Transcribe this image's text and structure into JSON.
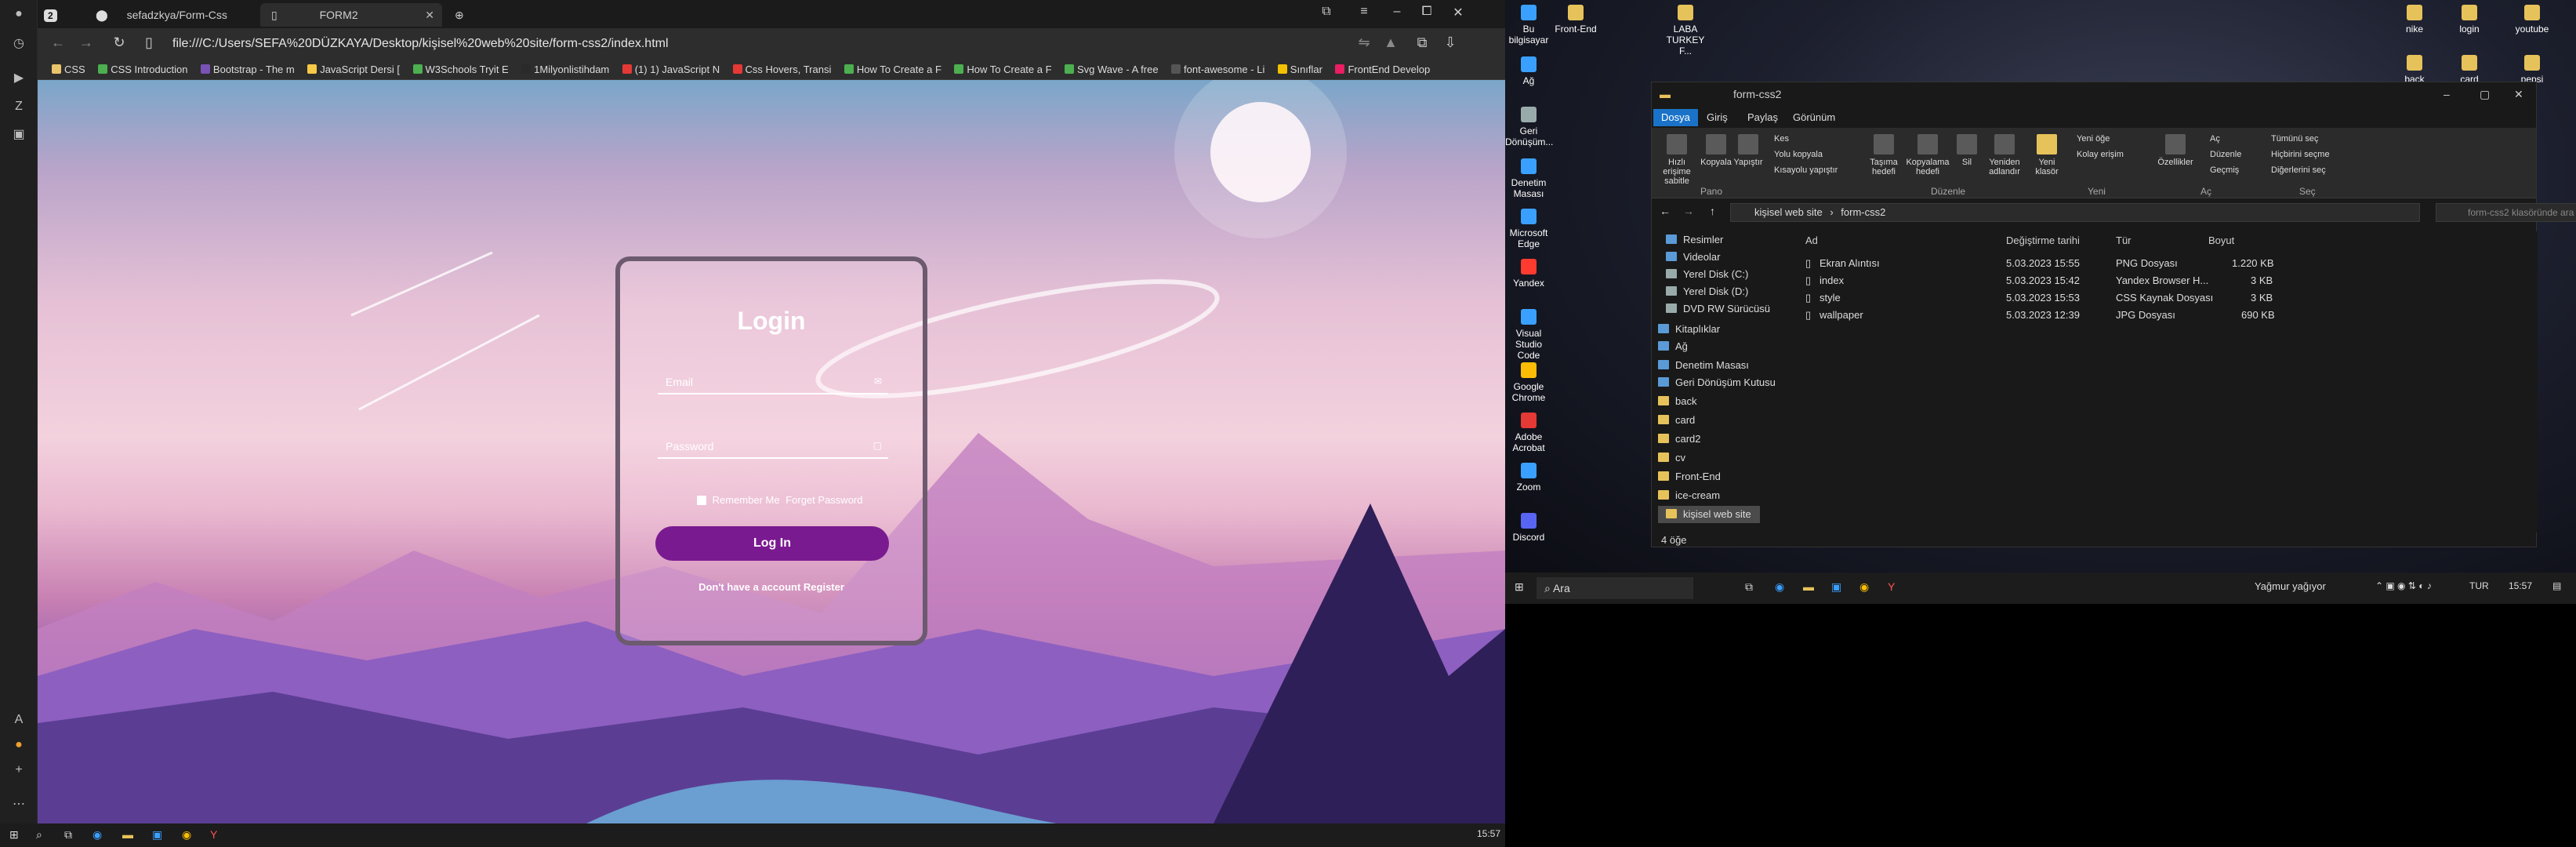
{
  "browser": {
    "tab_count": "2",
    "tabs": [
      {
        "title": "sefadzkya/Form-Css"
      },
      {
        "title": "FORM2"
      }
    ],
    "url": "file:///C:/Users/SEFA%20DÜZKAYA/Desktop/kişisel%20web%20site/form-css2/index.html",
    "bookmarks": [
      "CSS",
      "CSS Introduction",
      "Bootstrap - The m",
      "JavaScript Dersi [",
      "W3Schools Tryit E",
      "1Milyonlistihdam",
      "(1) 1) JavaScript N",
      "Css Hovers, Transi",
      "How To Create a F",
      "How To Create a F",
      "Svg Wave - A free",
      "font-awesome - Li",
      "Sınıflar",
      "FrontEnd Develop"
    ],
    "clock": "15:57"
  },
  "login": {
    "title": "Login",
    "email_label": "Email",
    "password_label": "Password",
    "remember_text": "Remember Me",
    "forgot_text": "Forget Password",
    "button": "Log In",
    "register_text": "Don't have a account Register"
  },
  "desktop_icons": [
    "Bu bilgisayar",
    "Front-End",
    "LABA TURKEY F...",
    "nike",
    "login",
    "youtube",
    "back",
    "card",
    "pepsi",
    "Ağ",
    "Geri Dönüşüm...",
    "Denetim Masası",
    "Microsoft Edge",
    "Yandex",
    "Visual Studio Code",
    "Google Chrome",
    "Adobe Acrobat",
    "Zoom",
    "Discord"
  ],
  "explorer": {
    "title": "form-css2",
    "ribbon_tabs": [
      "Dosya",
      "Giriş",
      "Paylaş",
      "Görünüm"
    ],
    "ribbon": {
      "pin": "Hızlı erişime sabitle",
      "copy": "Kopyala",
      "paste": "Yapıştır",
      "cut": "Kes",
      "copy_path": "Yolu kopyala",
      "paste_shortcut": "Kısayolu yapıştır",
      "move_to": "Taşıma hedefi",
      "copy_to": "Kopyalama hedefi",
      "delete": "Sil",
      "rename": "Yeniden adlandır",
      "new_folder": "Yeni klasör",
      "new_item": "Yeni öğe",
      "easy_access": "Kolay erişim",
      "properties": "Özellikler",
      "open": "Aç",
      "edit": "Düzenle",
      "history": "Geçmiş",
      "select_all": "Tümünü seç",
      "select_none": "Hiçbirini seçme",
      "invert": "Diğerlerini seç",
      "groups": [
        "Pano",
        "Düzenle",
        "Yeni",
        "Aç",
        "Seç"
      ]
    },
    "path": [
      "kişisel web site",
      "form-css2"
    ],
    "search_placeholder": "form-css2 klasöründe ara",
    "tree": [
      "Resimler",
      "Videolar",
      "Yerel Disk (C:)",
      "Yerel Disk (D:)",
      "DVD RW Sürücüsü",
      "Kitaplıklar",
      "Ağ",
      "Denetim Masası",
      "Geri Dönüşüm Kutusu",
      "back",
      "card",
      "card2",
      "cv",
      "Front-End",
      "ice-cream",
      "kişisel web site"
    ],
    "headers": [
      "Ad",
      "Değiştirme tarihi",
      "Tür",
      "Boyut"
    ],
    "files": [
      {
        "name": "Ekran Alıntısı",
        "date": "5.03.2023 15:55",
        "type": "PNG Dosyası",
        "size": "1.220 KB"
      },
      {
        "name": "index",
        "date": "5.03.2023 15:42",
        "type": "Yandex Browser H...",
        "size": "3 KB"
      },
      {
        "name": "style",
        "date": "5.03.2023 15:53",
        "type": "CSS Kaynak Dosyası",
        "size": "3 KB"
      },
      {
        "name": "wallpaper",
        "date": "5.03.2023 12:39",
        "type": "JPG Dosyası",
        "size": "690 KB"
      }
    ],
    "status": "4 öğe"
  },
  "taskbar": {
    "search": "Ara",
    "weather": "Yağmur yağıyor",
    "lang": "TUR",
    "time": "15:57"
  }
}
